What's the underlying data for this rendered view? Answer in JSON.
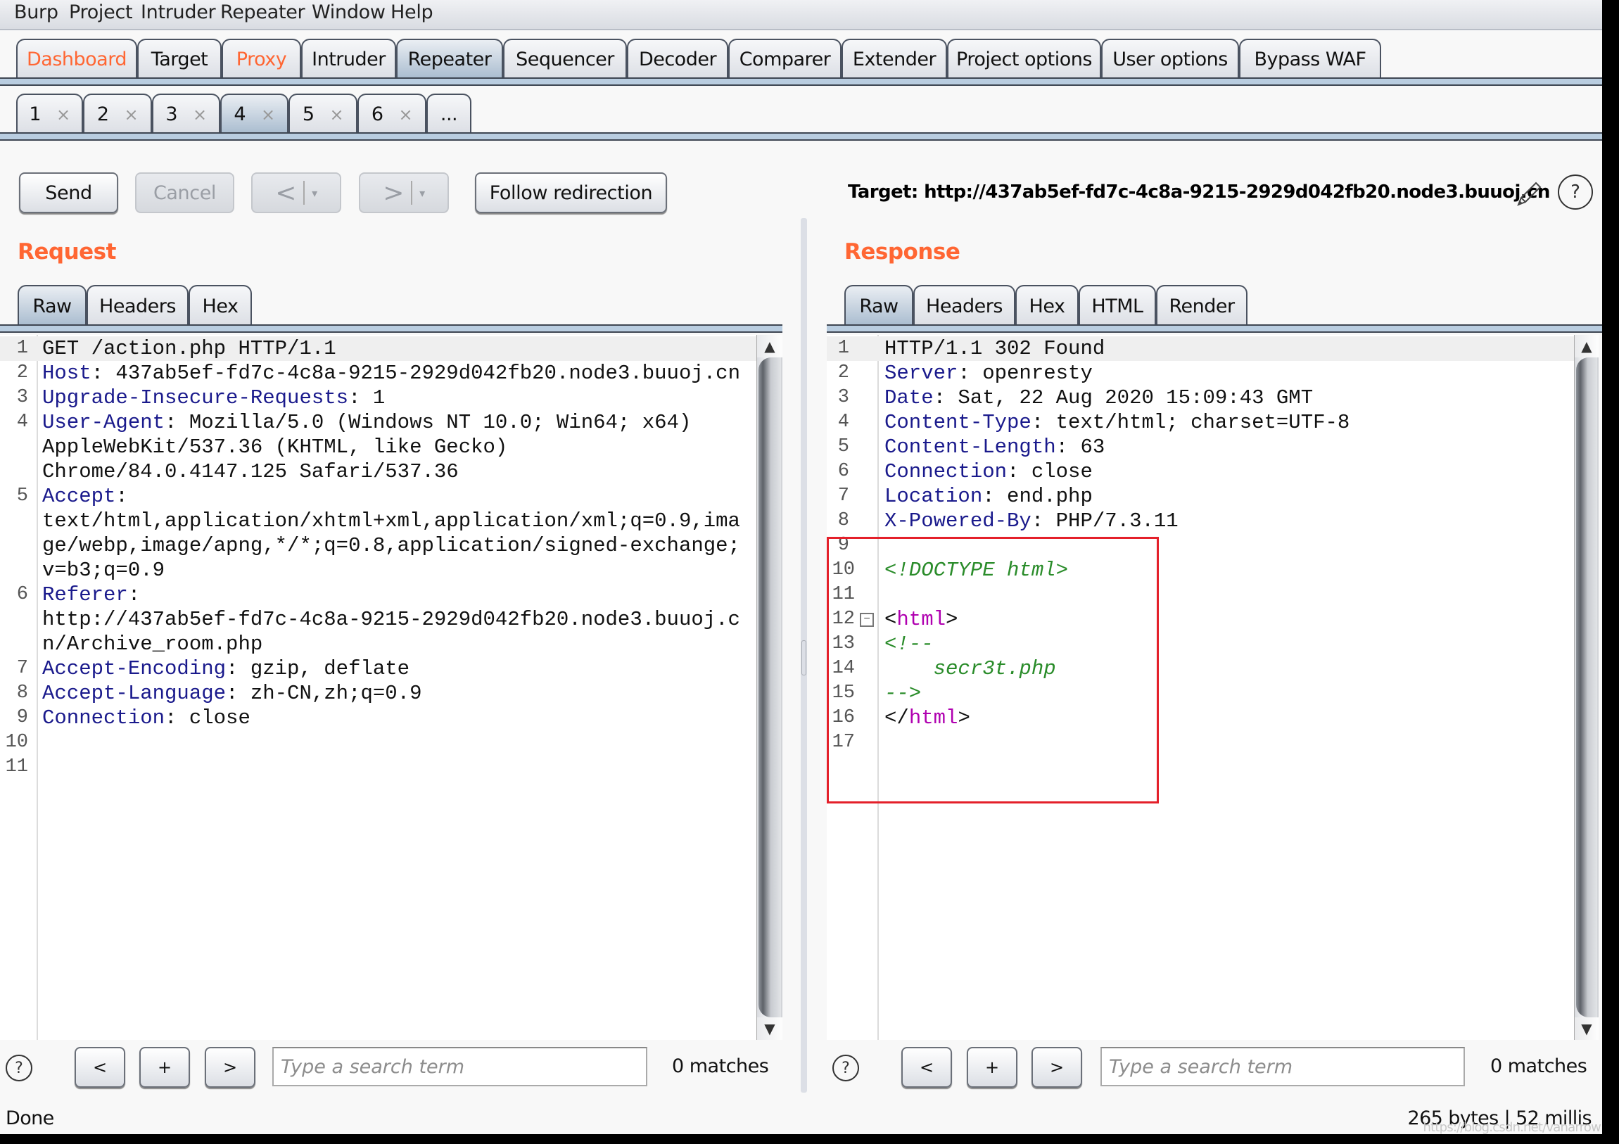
{
  "menu": [
    "Burp",
    "Project",
    "Intruder",
    "Repeater",
    "Window",
    "Help"
  ],
  "main_tabs": [
    {
      "label": "Dashboard",
      "state": "highlight"
    },
    {
      "label": "Target",
      "state": "normal"
    },
    {
      "label": "Proxy",
      "state": "highlight"
    },
    {
      "label": "Intruder",
      "state": "normal"
    },
    {
      "label": "Repeater",
      "state": "active"
    },
    {
      "label": "Sequencer",
      "state": "normal"
    },
    {
      "label": "Decoder",
      "state": "normal"
    },
    {
      "label": "Comparer",
      "state": "normal"
    },
    {
      "label": "Extender",
      "state": "normal"
    },
    {
      "label": "Project options",
      "state": "normal"
    },
    {
      "label": "User options",
      "state": "normal"
    },
    {
      "label": "Bypass WAF",
      "state": "normal"
    }
  ],
  "repeater_tabs": [
    {
      "label": "1",
      "close": "×"
    },
    {
      "label": "2",
      "close": "×"
    },
    {
      "label": "3",
      "close": "×"
    },
    {
      "label": "4",
      "close": "×",
      "active": true
    },
    {
      "label": "5",
      "close": "×"
    },
    {
      "label": "6",
      "close": "×"
    },
    {
      "label": "..."
    }
  ],
  "toolbar": {
    "send": "Send",
    "cancel": "Cancel",
    "back_glyph": "<",
    "forward_glyph": ">",
    "dropdown_glyph": "▾",
    "follow_redirection": "Follow redirection",
    "target_label": "Target: http://437ab5ef-fd7c-4c8a-9215-2929d042fb20.node3.buuoj.cn",
    "help_glyph": "?"
  },
  "request": {
    "title": "Request",
    "tabs": [
      "Raw",
      "Headers",
      "Hex"
    ],
    "active_tab": "Raw",
    "lines": [
      {
        "n": "1",
        "key": "",
        "text": "GET /action.php HTTP/1.1"
      },
      {
        "n": "2",
        "key": "Host",
        "text": ": 437ab5ef-fd7c-4c8a-9215-2929d042fb20.node3.buuoj.cn"
      },
      {
        "n": "3",
        "key": "Upgrade-Insecure-Requests",
        "text": ": 1"
      },
      {
        "n": "4",
        "key": "User-Agent",
        "text": ": Mozilla/5.0 (Windows NT 10.0; Win64; x64)"
      },
      {
        "n": "",
        "key": "",
        "text": "AppleWebKit/537.36 (KHTML, like Gecko)"
      },
      {
        "n": "",
        "key": "",
        "text": "Chrome/84.0.4147.125 Safari/537.36"
      },
      {
        "n": "5",
        "key": "Accept",
        "text": ":"
      },
      {
        "n": "",
        "key": "",
        "text": "text/html,application/xhtml+xml,application/xml;q=0.9,ima"
      },
      {
        "n": "",
        "key": "",
        "text": "ge/webp,image/apng,*/*;q=0.8,application/signed-exchange;"
      },
      {
        "n": "",
        "key": "",
        "text": "v=b3;q=0.9"
      },
      {
        "n": "6",
        "key": "Referer",
        "text": ":"
      },
      {
        "n": "",
        "key": "",
        "text": "http://437ab5ef-fd7c-4c8a-9215-2929d042fb20.node3.buuoj.c"
      },
      {
        "n": "",
        "key": "",
        "text": "n/Archive_room.php"
      },
      {
        "n": "7",
        "key": "Accept-Encoding",
        "text": ": gzip, deflate"
      },
      {
        "n": "8",
        "key": "Accept-Language",
        "text": ": zh-CN,zh;q=0.9"
      },
      {
        "n": "9",
        "key": "Connection",
        "text": ": close"
      },
      {
        "n": "10",
        "key": "",
        "text": ""
      },
      {
        "n": "11",
        "key": "",
        "text": ""
      }
    ],
    "search": {
      "placeholder": "Type a search term",
      "value": "",
      "matches": "0 matches",
      "prev": "<",
      "add": "+",
      "next": ">"
    }
  },
  "response": {
    "title": "Response",
    "tabs": [
      "Raw",
      "Headers",
      "Hex",
      "HTML",
      "Render"
    ],
    "active_tab": "Raw",
    "lines": [
      {
        "n": "1",
        "segs": [
          [
            "plain",
            "HTTP/1.1 302 Found"
          ]
        ]
      },
      {
        "n": "2",
        "segs": [
          [
            "key",
            "Server"
          ],
          [
            "plain",
            ": openresty"
          ]
        ]
      },
      {
        "n": "3",
        "segs": [
          [
            "key",
            "Date"
          ],
          [
            "plain",
            ": Sat, 22 Aug 2020 15:09:43 GMT"
          ]
        ]
      },
      {
        "n": "4",
        "segs": [
          [
            "key",
            "Content-Type"
          ],
          [
            "plain",
            ": text/html; charset=UTF-8"
          ]
        ]
      },
      {
        "n": "5",
        "segs": [
          [
            "key",
            "Content-Length"
          ],
          [
            "plain",
            ": 63"
          ]
        ]
      },
      {
        "n": "6",
        "segs": [
          [
            "key",
            "Connection"
          ],
          [
            "plain",
            ": close"
          ]
        ]
      },
      {
        "n": "7",
        "segs": [
          [
            "key",
            "Location"
          ],
          [
            "plain",
            ": end.php"
          ]
        ]
      },
      {
        "n": "8",
        "segs": [
          [
            "key",
            "X-Powered-By"
          ],
          [
            "plain",
            ": PHP/7.3.11"
          ]
        ]
      },
      {
        "n": "9",
        "segs": []
      },
      {
        "n": "10",
        "segs": [
          [
            "cmt",
            "<!DOCTYPE html>"
          ]
        ]
      },
      {
        "n": "11",
        "segs": []
      },
      {
        "n": "12",
        "fold": "⊟",
        "segs": [
          [
            "plain",
            "<"
          ],
          [
            "tag",
            "html"
          ],
          [
            "plain",
            ">"
          ]
        ]
      },
      {
        "n": "13",
        "segs": [
          [
            "cmt",
            "<!--"
          ]
        ]
      },
      {
        "n": "14",
        "segs": [
          [
            "cmt",
            "    secr3t.php"
          ]
        ]
      },
      {
        "n": "15",
        "segs": [
          [
            "cmt",
            "-->"
          ]
        ]
      },
      {
        "n": "16",
        "segs": [
          [
            "plain",
            "</"
          ],
          [
            "tag",
            "html"
          ],
          [
            "plain",
            ">"
          ]
        ]
      },
      {
        "n": "17",
        "segs": []
      }
    ],
    "search": {
      "placeholder": "Type a search term",
      "value": "",
      "matches": "0 matches",
      "prev": "<",
      "add": "+",
      "next": ">"
    }
  },
  "status": {
    "left": "Done",
    "right": "265 bytes | 52 millis",
    "watermark": "https://blog.csdn.net/vanarrow"
  },
  "colors": {
    "accent_orange": "#ff6633",
    "header_key": "#1a1a8c",
    "comment_green": "#2a8c2a",
    "tag_purple": "#b000b0",
    "annotation_red": "#e4202a"
  }
}
